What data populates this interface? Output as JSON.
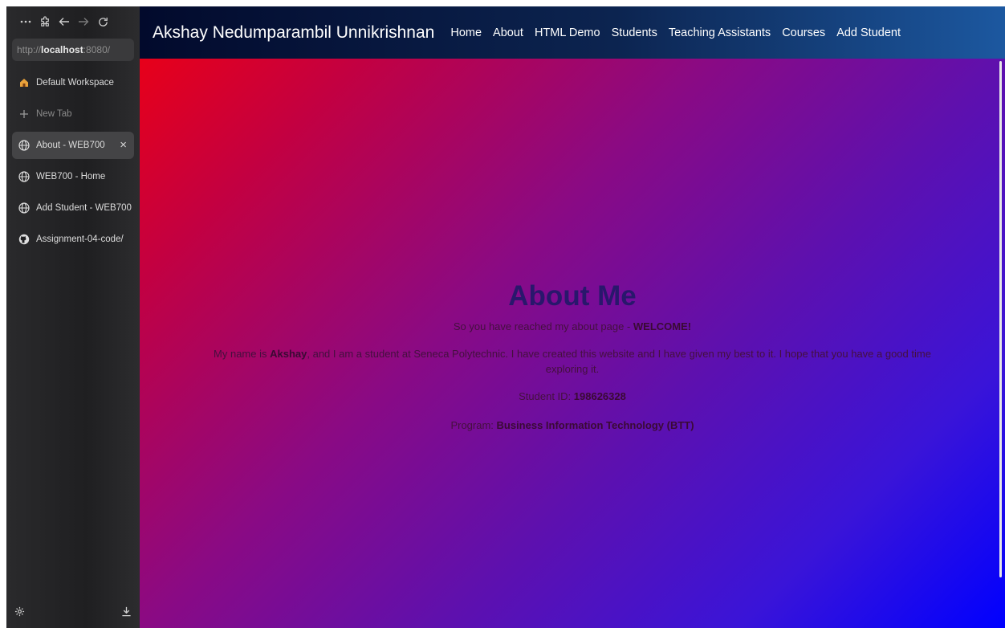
{
  "browser": {
    "url_prefix": "http://",
    "url_host": "localhost",
    "url_rest": ":8080/",
    "workspace_label": "Default Workspace",
    "new_tab_label": "New Tab",
    "tabs": [
      {
        "label": "About - WEB700",
        "active": true,
        "icon": "globe-icon"
      },
      {
        "label": "WEB700 - Home",
        "active": false,
        "icon": "globe-icon"
      },
      {
        "label": "Add Student - WEB700",
        "active": false,
        "icon": "globe-icon"
      },
      {
        "label": "Assignment-04-code/",
        "active": false,
        "icon": "github-icon"
      }
    ],
    "close_glyph": "×"
  },
  "site": {
    "brand": "Akshay Nedumparambil Unnikrishnan",
    "nav": [
      "Home",
      "About",
      "HTML Demo",
      "Students",
      "Teaching Assistants",
      "Courses",
      "Add Student"
    ]
  },
  "about": {
    "heading": "About Me",
    "line1_text": "So you have reached my about page - ",
    "line1_bold": "WELCOME!",
    "line2_a": "My name is ",
    "line2_name": "Akshay",
    "line2_b": ", and I am a student at Seneca Polytechnic. I have created this website and I have given my best to it. I hope that you have a good time exploring it.",
    "student_id_label": "Student ID: ",
    "student_id": "198626328",
    "program_label": "Program: ",
    "program": "Business Information Technology (BTT)"
  },
  "colors": {
    "gradient_start": "#f00010",
    "gradient_end": "#0000ff",
    "navbar": "#0c2450",
    "sidebar": "#1f1f21"
  }
}
